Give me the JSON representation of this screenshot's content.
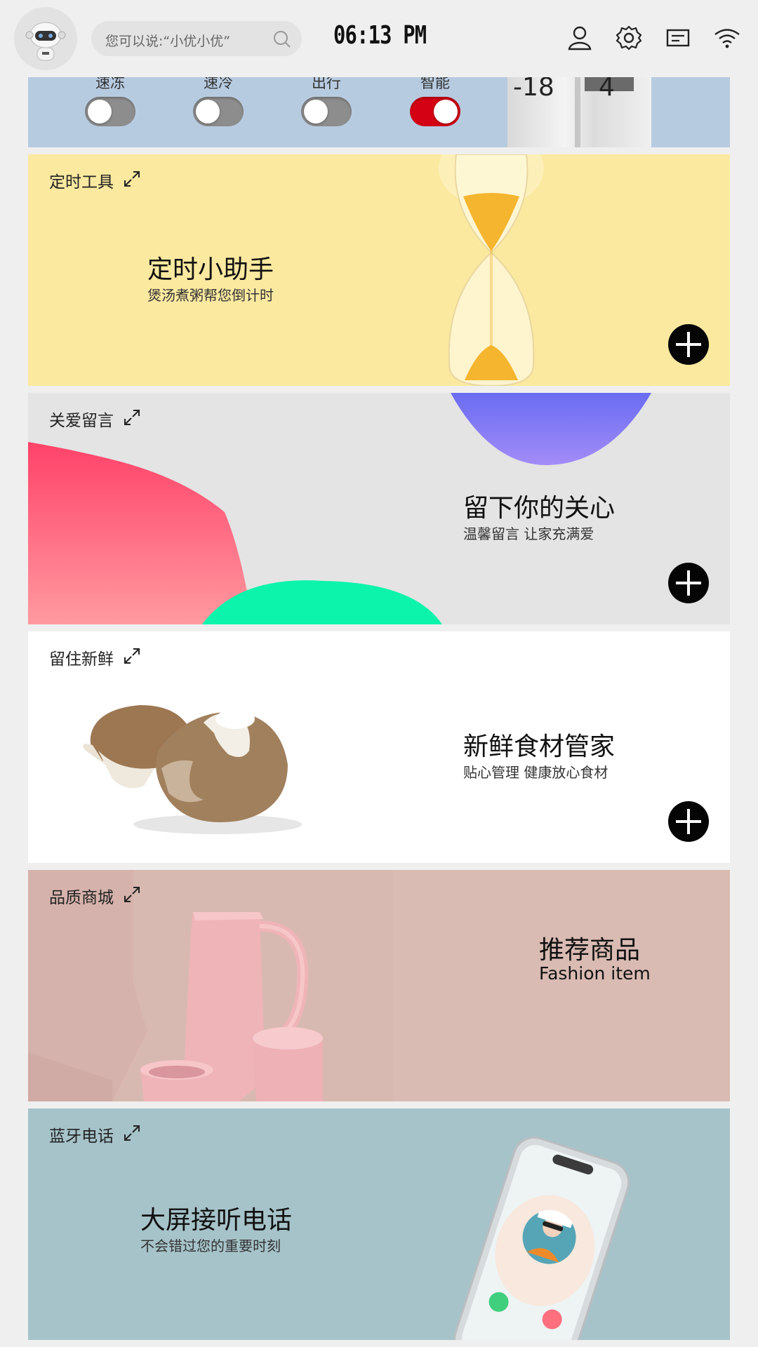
{
  "header": {
    "search_placeholder": "您可以说:“小优小优”",
    "time": "06:13 PM",
    "icons": [
      "robot-avatar",
      "search-icon",
      "user-icon",
      "gear-icon",
      "message-icon",
      "wifi-icon"
    ]
  },
  "controls": {
    "toggles": [
      {
        "label": "速冻",
        "on": false
      },
      {
        "label": "速冷",
        "on": false
      },
      {
        "label": "出行",
        "on": false
      },
      {
        "label": "智能",
        "on": true
      }
    ],
    "fridge_left_temp": "-18",
    "fridge_right_temp": "4"
  },
  "cards": [
    {
      "label": "定时工具",
      "title": "定时小助手",
      "subtitle": "煲汤煮粥帮您倒计时",
      "bg": "#fbe9a0"
    },
    {
      "label": "关爱留言",
      "title": "留下你的关心",
      "subtitle": "温馨留言 让家充满爱",
      "bg": "#e4e4e4"
    },
    {
      "label": "留住新鲜",
      "title": "新鲜食材管家",
      "subtitle": "贴心管理 健康放心食材",
      "bg": "#ffffff"
    },
    {
      "label": "品质商城",
      "title": "推荐商品",
      "subtitle": "Fashion item",
      "bg": "#d9bbb3"
    },
    {
      "label": "蓝牙电话",
      "title": "大屏接听电话",
      "subtitle": "不会错过您的重要时刻",
      "bg": "#a6c3c9"
    }
  ],
  "colors": {
    "toggle_on": "#d40014",
    "toggle_off": "#8d8d8d",
    "plus_button": "#050505"
  }
}
